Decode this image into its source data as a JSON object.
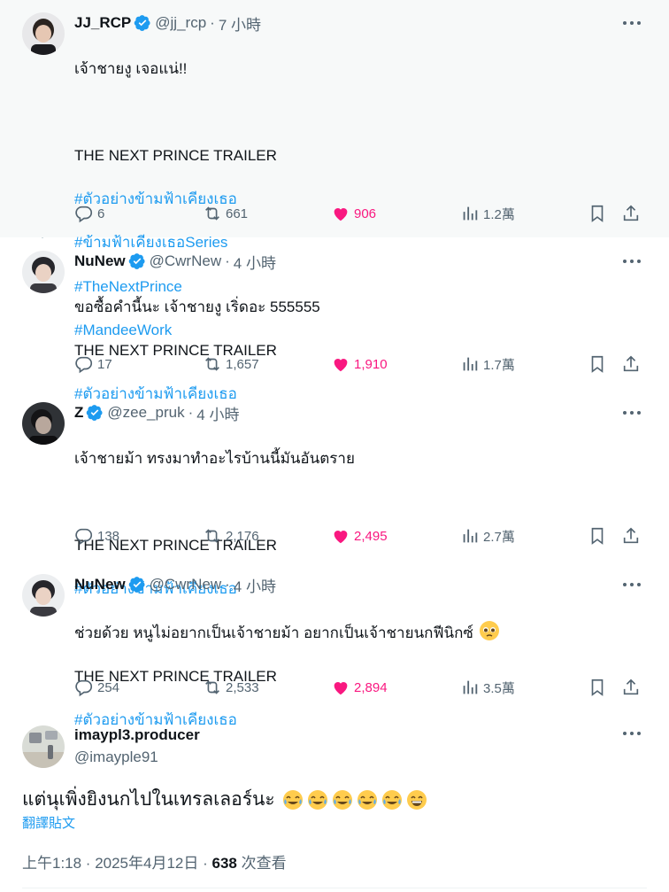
{
  "colors": {
    "accent": "#1d9bf0",
    "like": "#f91880",
    "muted": "#536471",
    "text": "#0f1419"
  },
  "tweets": [
    {
      "name": "JJ_RCP",
      "handle": "@jj_rcp",
      "time": "7 小時",
      "lines": [
        "เจ้าชายงู เจอแน่!!",
        "",
        "THE NEXT PRINCE TRAILER"
      ],
      "hashtags": [
        "#ตัวอย่างข้ามฟ้าเคียงเธอ",
        "#ข้ามฟ้าเคียงเธอSeries",
        "#TheNextPrince",
        "#MandeeWork"
      ],
      "replies": "6",
      "retweets": "661",
      "likes": "906",
      "views": "1.2萬"
    },
    {
      "name": "NuNew",
      "handle": "@CwrNew",
      "time": "4 小時",
      "lines": [
        "ขอซื้อคำนี้นะ เจ้าชายงู เริ่ดอะ 555555",
        "THE NEXT PRINCE TRAILER"
      ],
      "hashtags": [
        "#ตัวอย่างข้ามฟ้าเคียงเธอ"
      ],
      "replies": "17",
      "retweets": "1,657",
      "likes": "1,910",
      "views": "1.7萬"
    },
    {
      "name": "Z",
      "handle": "@zee_pruk",
      "time": "4 小時",
      "lines": [
        "เจ้าชายม้า ทรงมาทำอะไรบ้านนี้มันอันตราย",
        "",
        "THE NEXT PRINCE TRAILER"
      ],
      "hashtags": [
        "#ตัวอย่างข้ามฟ้าเคียงเธอ"
      ],
      "replies": "138",
      "retweets": "2,176",
      "likes": "2,495",
      "views": "2.7萬"
    },
    {
      "name": "NuNew",
      "handle": "@CwrNew",
      "time": "4 小時",
      "lines": [
        "ช่วยด้วย หนูไม่อยากเป็นเจ้าชายม้า อยากเป็นเจ้าชายนกฟีนิกซ์",
        "THE NEXT PRINCE TRAILER"
      ],
      "hashtags": [
        "#ตัวอย่างข้ามฟ้าเคียงเธอ"
      ],
      "replies": "254",
      "retweets": "2,533",
      "likes": "2,894",
      "views": "3.5萬"
    }
  ],
  "main_post": {
    "name": "imaypl3.producer",
    "handle": "@imayple91",
    "text": "แต่นุเพิ่งยิงนกไปในเทรลเลอร์นะ",
    "emojis": [
      "tears-of-joy",
      "tears-of-joy",
      "tears-of-joy",
      "tears-of-joy",
      "tears-of-joy",
      "grinning"
    ],
    "translate_label": "翻譯貼文",
    "timestamp": "上午1:18 · 2025年4月12日",
    "views_count": "638",
    "views_label": "次查看"
  }
}
